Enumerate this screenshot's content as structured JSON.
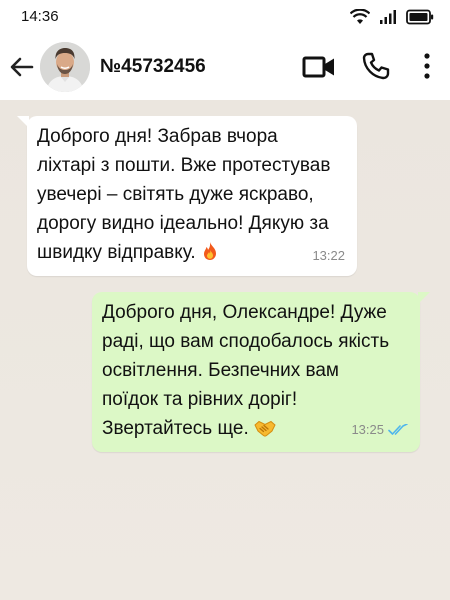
{
  "status_bar": {
    "time": "14:36",
    "icons": [
      "wifi-icon",
      "signal-icon",
      "battery-icon"
    ]
  },
  "header": {
    "back_icon": "arrow-left-icon",
    "contact_name": "№45732456",
    "video_icon": "video-camera-icon",
    "call_icon": "phone-icon",
    "menu_icon": "more-vertical-icon"
  },
  "messages": [
    {
      "direction": "incoming",
      "text": " Доброго дня! Забрав вчора\nліхтарі з пошти. Вже протестував\nувечері – світять дуже яскраво,\nдорогу видно ідеально! Дякую за\nшвидку відправку. ",
      "emoji_icon": "fire-emoji",
      "time": "13:22"
    },
    {
      "direction": "outgoing",
      "text": " Доброго дня, Олександре! Дуже\nраді, що вам сподобалось якість\nосвітлення. Безпечних вам\nпоїдок та рівних доріг!\nЗвертайтесь ще. ",
      "emoji_icon": "handshake-emoji",
      "time": "13:25",
      "status_icon": "double-check-icon"
    }
  ],
  "colors": {
    "chat_background": "#ede8e1",
    "incoming_bubble": "#ffffff",
    "outgoing_bubble": "#dcf8c6",
    "read_check": "#4fb6ec"
  }
}
